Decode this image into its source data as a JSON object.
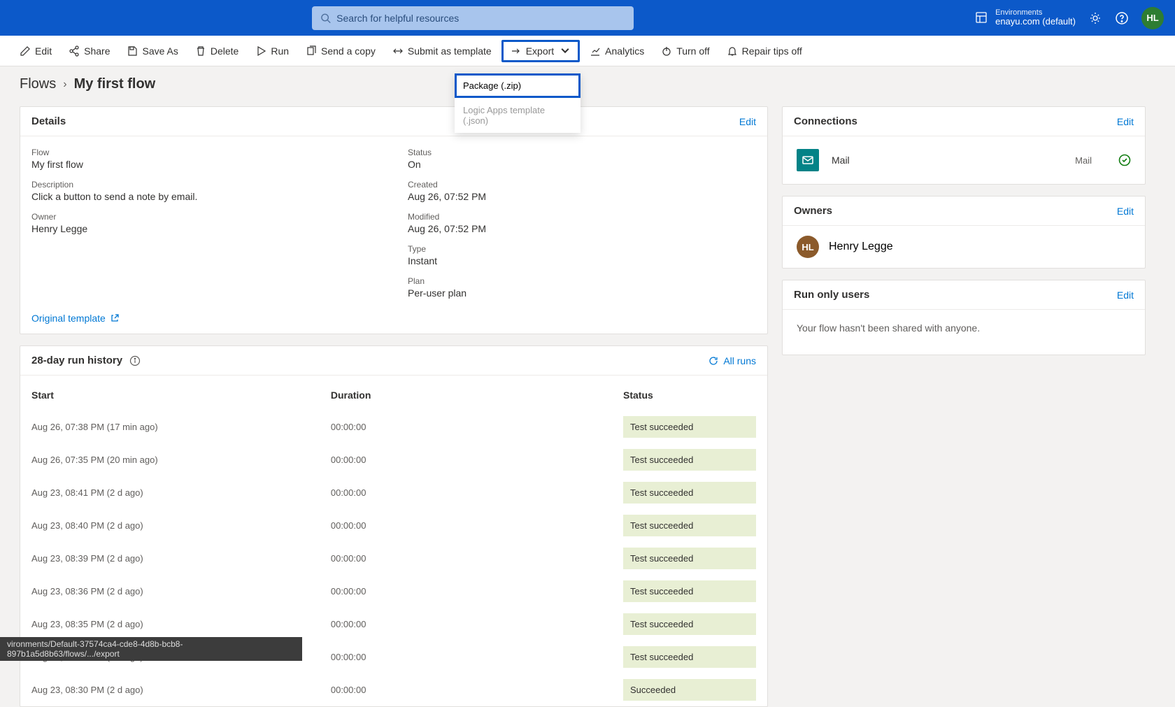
{
  "header": {
    "search_placeholder": "Search for helpful resources",
    "env_label": "Environments",
    "env_name": "enayu.com (default)",
    "avatar_initials": "HL"
  },
  "commands": {
    "edit": "Edit",
    "share": "Share",
    "save_as": "Save As",
    "delete": "Delete",
    "run": "Run",
    "send_copy": "Send a copy",
    "submit_template": "Submit as template",
    "export": "Export",
    "analytics": "Analytics",
    "turn_off": "Turn off",
    "repair_tips": "Repair tips off"
  },
  "export_menu": {
    "package": "Package (.zip)",
    "logic_apps": "Logic Apps template (.json)"
  },
  "breadcrumb": {
    "parent": "Flows",
    "current": "My first flow"
  },
  "details": {
    "title": "Details",
    "edit": "Edit",
    "flow_label": "Flow",
    "flow_value": "My first flow",
    "description_label": "Description",
    "description_value": "Click a button to send a note by email.",
    "owner_label": "Owner",
    "owner_value": "Henry Legge",
    "status_label": "Status",
    "status_value": "On",
    "created_label": "Created",
    "created_value": "Aug 26, 07:52 PM",
    "modified_label": "Modified",
    "modified_value": "Aug 26, 07:52 PM",
    "type_label": "Type",
    "type_value": "Instant",
    "plan_label": "Plan",
    "plan_value": "Per-user plan",
    "original_template": "Original template"
  },
  "history": {
    "title": "28-day run history",
    "all_runs": "All runs",
    "col_start": "Start",
    "col_duration": "Duration",
    "col_status": "Status",
    "rows": [
      {
        "start": "Aug 26, 07:38 PM (17 min ago)",
        "duration": "00:00:00",
        "status": "Test succeeded"
      },
      {
        "start": "Aug 26, 07:35 PM (20 min ago)",
        "duration": "00:00:00",
        "status": "Test succeeded"
      },
      {
        "start": "Aug 23, 08:41 PM (2 d ago)",
        "duration": "00:00:00",
        "status": "Test succeeded"
      },
      {
        "start": "Aug 23, 08:40 PM (2 d ago)",
        "duration": "00:00:00",
        "status": "Test succeeded"
      },
      {
        "start": "Aug 23, 08:39 PM (2 d ago)",
        "duration": "00:00:00",
        "status": "Test succeeded"
      },
      {
        "start": "Aug 23, 08:36 PM (2 d ago)",
        "duration": "00:00:00",
        "status": "Test succeeded"
      },
      {
        "start": "Aug 23, 08:35 PM (2 d ago)",
        "duration": "00:00:00",
        "status": "Test succeeded"
      },
      {
        "start": "Aug 23, 08:32 PM (2 d ago)",
        "duration": "00:00:00",
        "status": "Test succeeded"
      },
      {
        "start": "Aug 23, 08:30 PM (2 d ago)",
        "duration": "00:00:00",
        "status": "Succeeded"
      }
    ]
  },
  "connections": {
    "title": "Connections",
    "edit": "Edit",
    "items": [
      {
        "name": "Mail",
        "type": "Mail"
      }
    ]
  },
  "owners": {
    "title": "Owners",
    "edit": "Edit",
    "items": [
      {
        "initials": "HL",
        "name": "Henry Legge"
      }
    ]
  },
  "run_only": {
    "title": "Run only users",
    "edit": "Edit",
    "text": "Your flow hasn't been shared with anyone."
  },
  "status_url": "vironments/Default-37574ca4-cde8-4d8b-bcb8-897b1a5d8b63/flows/.../export"
}
